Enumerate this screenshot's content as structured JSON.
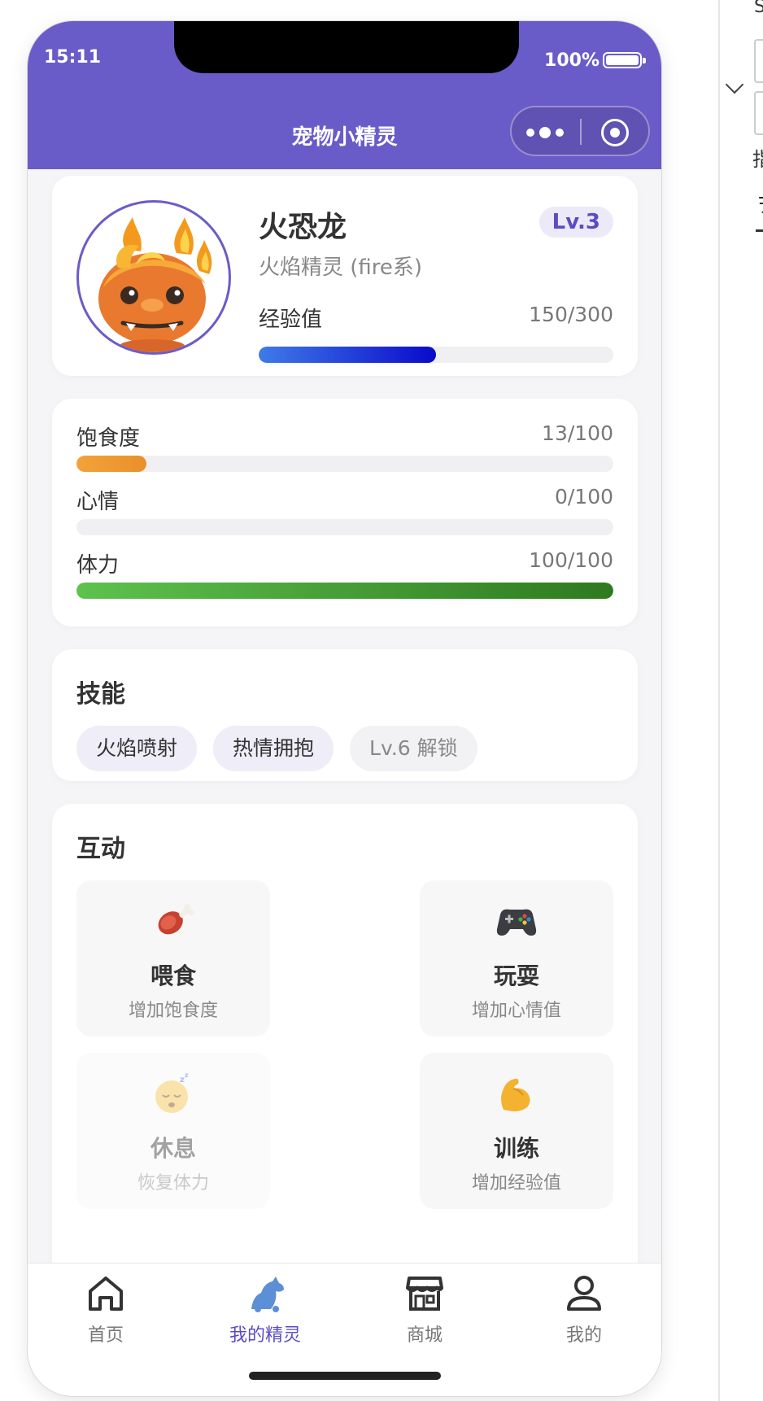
{
  "status_bar": {
    "time": "15:11",
    "battery": "100%"
  },
  "nav": {
    "title": "宠物小精灵"
  },
  "pet": {
    "name": "火恐龙",
    "level": "Lv.3",
    "type": "火焰精灵 (fire系)",
    "exp_label": "经验值",
    "exp_value": "150/300",
    "exp_fraction": 0.5
  },
  "stats": [
    {
      "label": "饱食度",
      "value": "13/100",
      "fraction": 0.13,
      "color": "#f2a33a"
    },
    {
      "label": "心情",
      "value": "0/100",
      "fraction": 0.0,
      "color": "#e6e6ea"
    },
    {
      "label": "体力",
      "value": "100/100",
      "fraction": 1.0,
      "color": "#3a8a28"
    }
  ],
  "skills": {
    "title": "技能",
    "items": [
      "火焰喷射",
      "热情拥抱"
    ],
    "locked": "Lv.6 解锁"
  },
  "interact": {
    "title": "互动",
    "actions": [
      {
        "icon": "meat-icon",
        "title": "喂食",
        "desc": "增加饱食度"
      },
      {
        "icon": "gamepad-icon",
        "title": "玩耍",
        "desc": "增加心情值"
      },
      {
        "icon": "sleep-face-icon",
        "title": "休息",
        "desc": "恢复体力"
      },
      {
        "icon": "muscle-icon",
        "title": "训练",
        "desc": "增加经验值"
      }
    ]
  },
  "tabbar": {
    "items": [
      {
        "label": "首页",
        "icon": "home-icon"
      },
      {
        "label": "我的精灵",
        "icon": "pet-icon"
      },
      {
        "label": "商城",
        "icon": "shop-icon"
      },
      {
        "label": "我的",
        "icon": "user-icon"
      }
    ],
    "active": "我的精灵"
  },
  "side_panel": {
    "top_text": "S",
    "text1": "指",
    "text2": "ヲ"
  },
  "colors": {
    "brand": "#6a5cc8",
    "accent_text": "#5b4cc4"
  }
}
